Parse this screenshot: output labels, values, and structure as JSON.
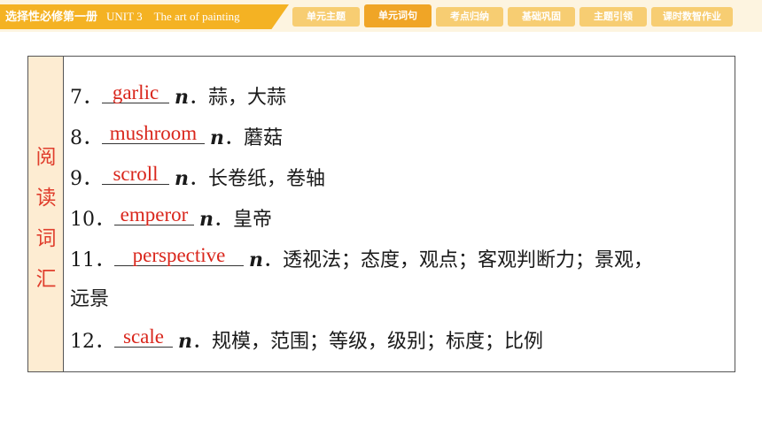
{
  "header": {
    "course_title": "选择性必修第一册",
    "unit_title": "UNIT 3　The art of painting",
    "nav_items": [
      {
        "label": "单元主题",
        "active": false
      },
      {
        "label": "单元词句",
        "active": true
      },
      {
        "label": "考点归纳",
        "active": false
      },
      {
        "label": "基础巩固",
        "active": false
      },
      {
        "label": "主题引领",
        "active": false
      },
      {
        "label": "课时数智作业",
        "active": false
      }
    ]
  },
  "sidebar": {
    "chars": [
      "阅",
      "读",
      "词",
      "汇"
    ]
  },
  "entries": [
    {
      "num": "7．",
      "answer": "garlic",
      "pos": "n",
      "meaning": "．蒜，大蒜"
    },
    {
      "num": "8．",
      "answer": "mushroom",
      "pos": "n",
      "meaning": "．蘑菇"
    },
    {
      "num": "9．",
      "answer": "scroll",
      "pos": "n",
      "meaning": "．长卷纸，卷轴"
    },
    {
      "num": "10．",
      "answer": "emperor",
      "pos": "n",
      "meaning": "．皇帝"
    },
    {
      "num": "11．",
      "answer": "perspective",
      "pos": "n",
      "meaning": "．透视法；态度，观点；客观判断力；景观，",
      "meaning_cont": "远景"
    },
    {
      "num": "12．",
      "answer": "scale",
      "pos": "n",
      "meaning": "．规模，范围；等级，级别；标度；比例"
    }
  ],
  "colors": {
    "accent": "#f4b223",
    "answer": "#d9261c",
    "sidebar_bg": "#fdecd2"
  }
}
